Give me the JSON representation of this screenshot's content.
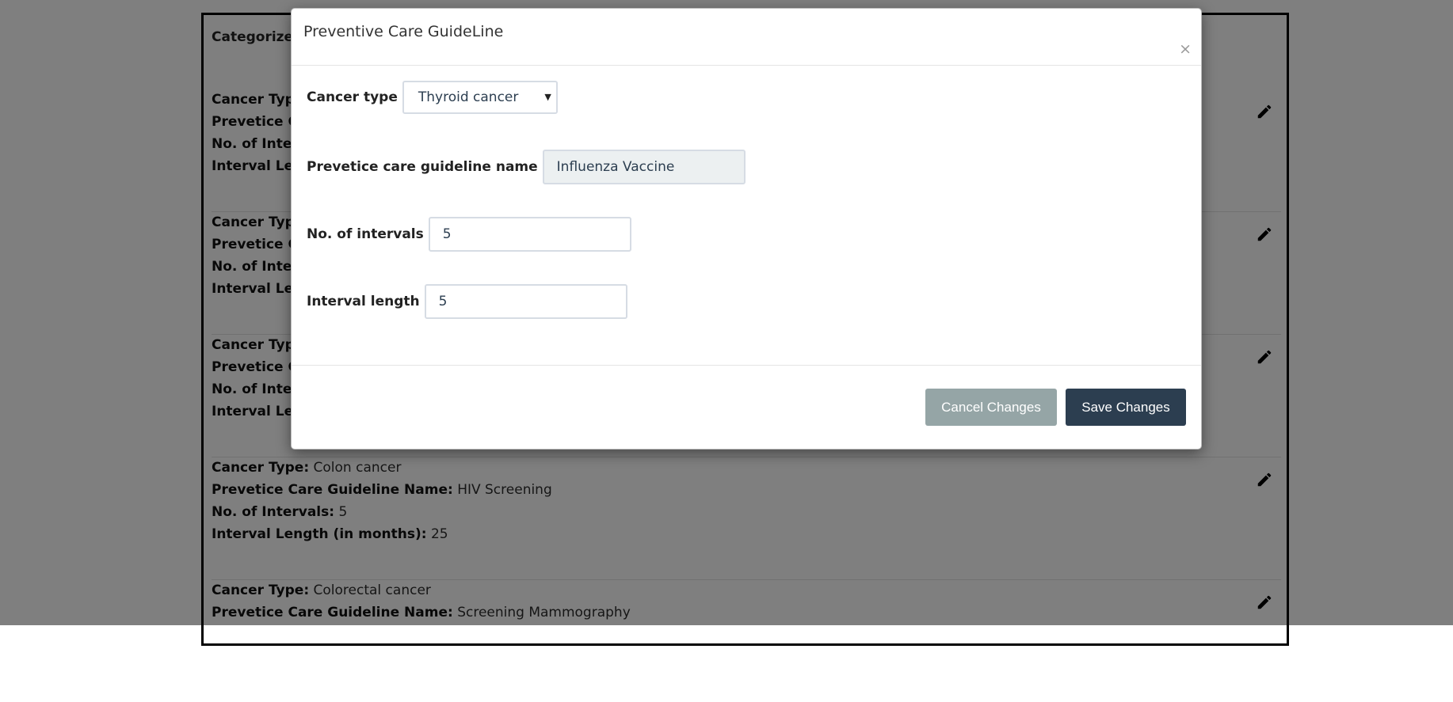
{
  "page": {
    "title": "Categorize",
    "labels": {
      "cancer_type": "Cancer Typ",
      "guideline_name": "Prevetice C",
      "intervals": "No. of Inte",
      "interval_length": "Interval Le"
    },
    "full_labels": {
      "cancer_type": "Cancer Type:",
      "guideline_name": "Prevetice Care Guideline Name:",
      "intervals": "No. of Intervals:",
      "interval_length": "Interval Length (in months):"
    },
    "records": [
      {
        "cancer_type": "",
        "guideline_name": "",
        "intervals": "",
        "interval_length": ""
      },
      {
        "cancer_type": "",
        "guideline_name": "",
        "intervals": "",
        "interval_length": ""
      },
      {
        "cancer_type": "",
        "guideline_name": "",
        "intervals": "",
        "interval_length": ""
      },
      {
        "cancer_type": "Colon cancer",
        "guideline_name": "HIV Screening",
        "intervals": "5",
        "interval_length": "25"
      },
      {
        "cancer_type": "Colorectal cancer",
        "guideline_name": "Screening Mammography"
      }
    ],
    "edit_icon": "pencil-icon"
  },
  "modal": {
    "title": "Preventive Care GuideLine",
    "close_glyph": "×",
    "fields": {
      "cancer_type_label": "Cancer type",
      "cancer_type_value": "Thyroid cancer",
      "guideline_label": "Prevetice care guideline name",
      "guideline_value": "Influenza Vaccine",
      "intervals_label": "No. of intervals",
      "intervals_value": "5",
      "interval_length_label": "Interval length",
      "interval_length_value": "5"
    },
    "buttons": {
      "cancel": "Cancel Changes",
      "save": "Save Changes"
    }
  },
  "colors": {
    "save_button": "#2c3e50",
    "cancel_button": "#95a5a6",
    "backdrop": "rgba(0,0,0,0.5)"
  }
}
